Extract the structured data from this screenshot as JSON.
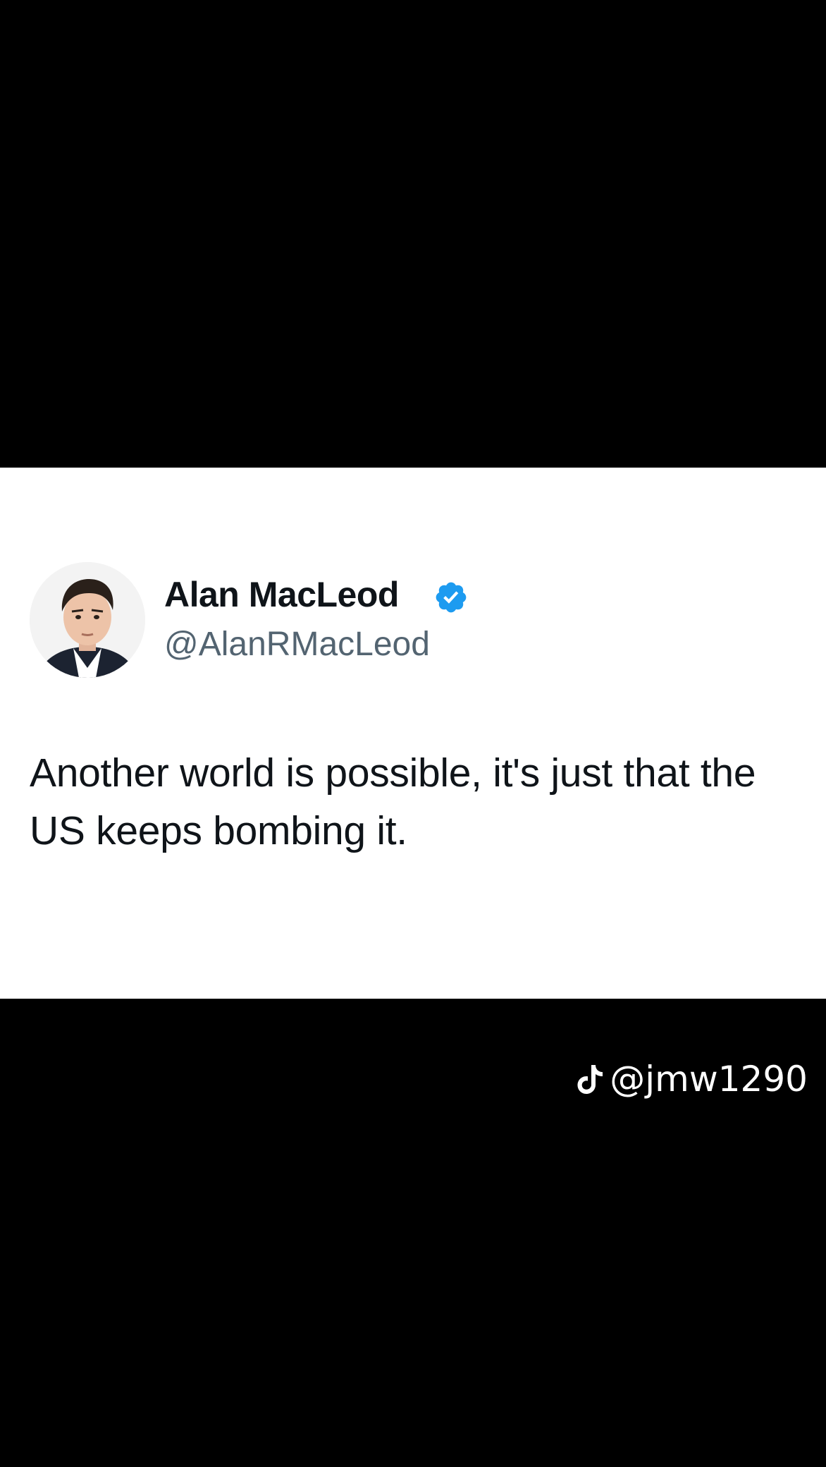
{
  "tweet": {
    "author_name": "Alan MacLeod",
    "author_handle": "@AlanRMacLeod",
    "verified": true,
    "text": "Another world is possible, it's just that the US keeps bombing it."
  },
  "watermark": {
    "icon": "tiktok-icon",
    "text": "@jmw1290"
  },
  "colors": {
    "background": "#000000",
    "card": "#ffffff",
    "verified_blue": "#1d9bf0",
    "handle_gray": "#536471",
    "text_dark": "#0f1419"
  }
}
